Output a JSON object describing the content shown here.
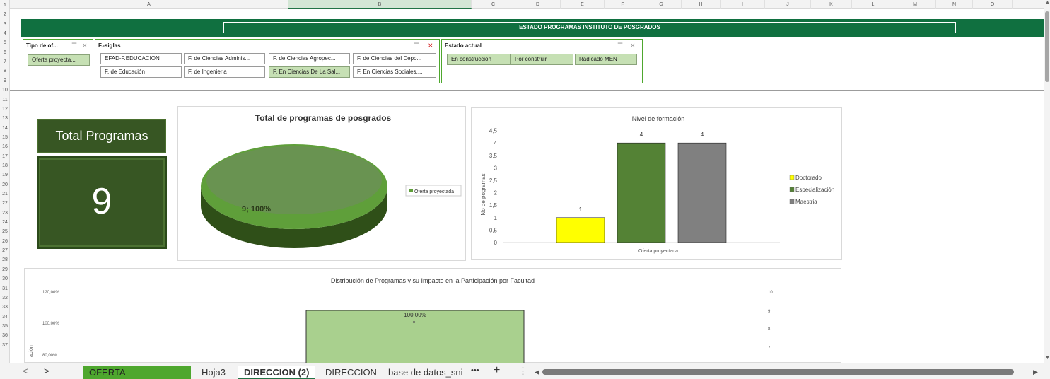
{
  "spreadsheet": {
    "columns": [
      "A",
      "B",
      "C",
      "D",
      "E",
      "F",
      "G",
      "H",
      "I",
      "J",
      "K",
      "L",
      "M",
      "N",
      "O"
    ],
    "selected_column": "B",
    "rows": [
      "1",
      "2",
      "3",
      "4",
      "5",
      "6",
      "7",
      "8",
      "9",
      "10",
      "11",
      "12",
      "13",
      "14",
      "15",
      "16",
      "17",
      "18",
      "19",
      "20",
      "21",
      "22",
      "23",
      "24",
      "25",
      "26",
      "27",
      "28",
      "29",
      "30",
      "31",
      "32",
      "33",
      "34",
      "35",
      "36",
      "37"
    ]
  },
  "banner": {
    "title": "ESTADO PROGRAMAS INSTITUTO DE POSGRADOS"
  },
  "slicers": {
    "tipo": {
      "title": "Tipo de of...",
      "items": [
        {
          "label": "Oferta proyecta...",
          "selected": true
        }
      ]
    },
    "fsiglas": {
      "title": "F.-siglas",
      "items": [
        {
          "label": "EFAD-F.EDUCACION",
          "selected": false
        },
        {
          "label": "F. de Ciencias Adminis...",
          "selected": false
        },
        {
          "label": "F. de Ciencias Agropec...",
          "selected": false
        },
        {
          "label": "F. de Ciencias del Depo...",
          "selected": false
        },
        {
          "label": "F. de Educación",
          "selected": false
        },
        {
          "label": "F. de Ingenieria",
          "selected": false
        },
        {
          "label": "F. En Ciencias De La Sal...",
          "selected": true
        },
        {
          "label": "F. En Ciencias Sociales,...",
          "selected": false
        }
      ]
    },
    "estado": {
      "title": "Estado actual",
      "items": [
        {
          "label": "En construcción",
          "selected": true
        },
        {
          "label": "Por construir",
          "selected": true
        },
        {
          "label": "Radicado MEN",
          "selected": true
        }
      ]
    }
  },
  "kpi": {
    "title": "Total Programas",
    "value": "9"
  },
  "charts": {
    "pie": {
      "title": "Total de programas de posgrados",
      "data_label": "9; 100%",
      "legend": "Oferta proyectada"
    },
    "bar": {
      "title": "Nivel de formación",
      "ylabel": "No de pogramas",
      "xcategory": "Oferta proyectada"
    },
    "combo": {
      "title": "Distribución de Programas y su Impacto en la Participación por Facultad",
      "ylabel_fragment": "ación",
      "bar_label": "100,00%"
    }
  },
  "chart_data": [
    {
      "type": "pie",
      "title": "Total de programas de posgrados",
      "categories": [
        "Oferta proyectada"
      ],
      "values": [
        9
      ],
      "labels": [
        "9; 100%"
      ],
      "legend": [
        "Oferta proyectada"
      ],
      "legend_position": "right"
    },
    {
      "type": "bar",
      "title": "Nivel de formación",
      "ylabel": "No de pogramas",
      "categories": [
        "Oferta proyectada"
      ],
      "series": [
        {
          "name": "Doctorado",
          "values": [
            1
          ],
          "color": "#ffff00"
        },
        {
          "name": "Especialización",
          "values": [
            4
          ],
          "color": "#548235"
        },
        {
          "name": "Maestria",
          "values": [
            4
          ],
          "color": "#808080"
        }
      ],
      "ylim": [
        0,
        4.5
      ],
      "yticks": [
        "0",
        "0,5",
        "1",
        "1,5",
        "2",
        "2,5",
        "3",
        "3,5",
        "4",
        "4,5"
      ],
      "legend_position": "right"
    },
    {
      "type": "bar",
      "title": "Distribución de Programas y su Impacto en la Participación por Facultad",
      "left_ticks_visible": [
        "80,00%",
        "100,00%",
        "120,00%"
      ],
      "right_ticks_visible": [
        "7",
        "8",
        "9",
        "10"
      ],
      "series": [
        {
          "values": [
            100
          ],
          "color": "#a9d08e",
          "label": "100,00%"
        }
      ]
    }
  ],
  "sheet_tabs": [
    {
      "label": "OFERTA POSGRADOS",
      "state": "colored"
    },
    {
      "label": "Hoja3",
      "state": "normal"
    },
    {
      "label": "DIRECCION (2)",
      "state": "active"
    },
    {
      "label": "DIRECCION",
      "state": "normal"
    },
    {
      "label": "base de datos_sni",
      "state": "normal"
    }
  ],
  "nav": {
    "prev": "<",
    "next": ">",
    "more": "•••",
    "add": "+",
    "options": "⋮"
  },
  "colors": {
    "excel_green": "#217346",
    "banner": "#107040",
    "kpi": "#375623",
    "slicer_selected": "#c6e0b4"
  }
}
